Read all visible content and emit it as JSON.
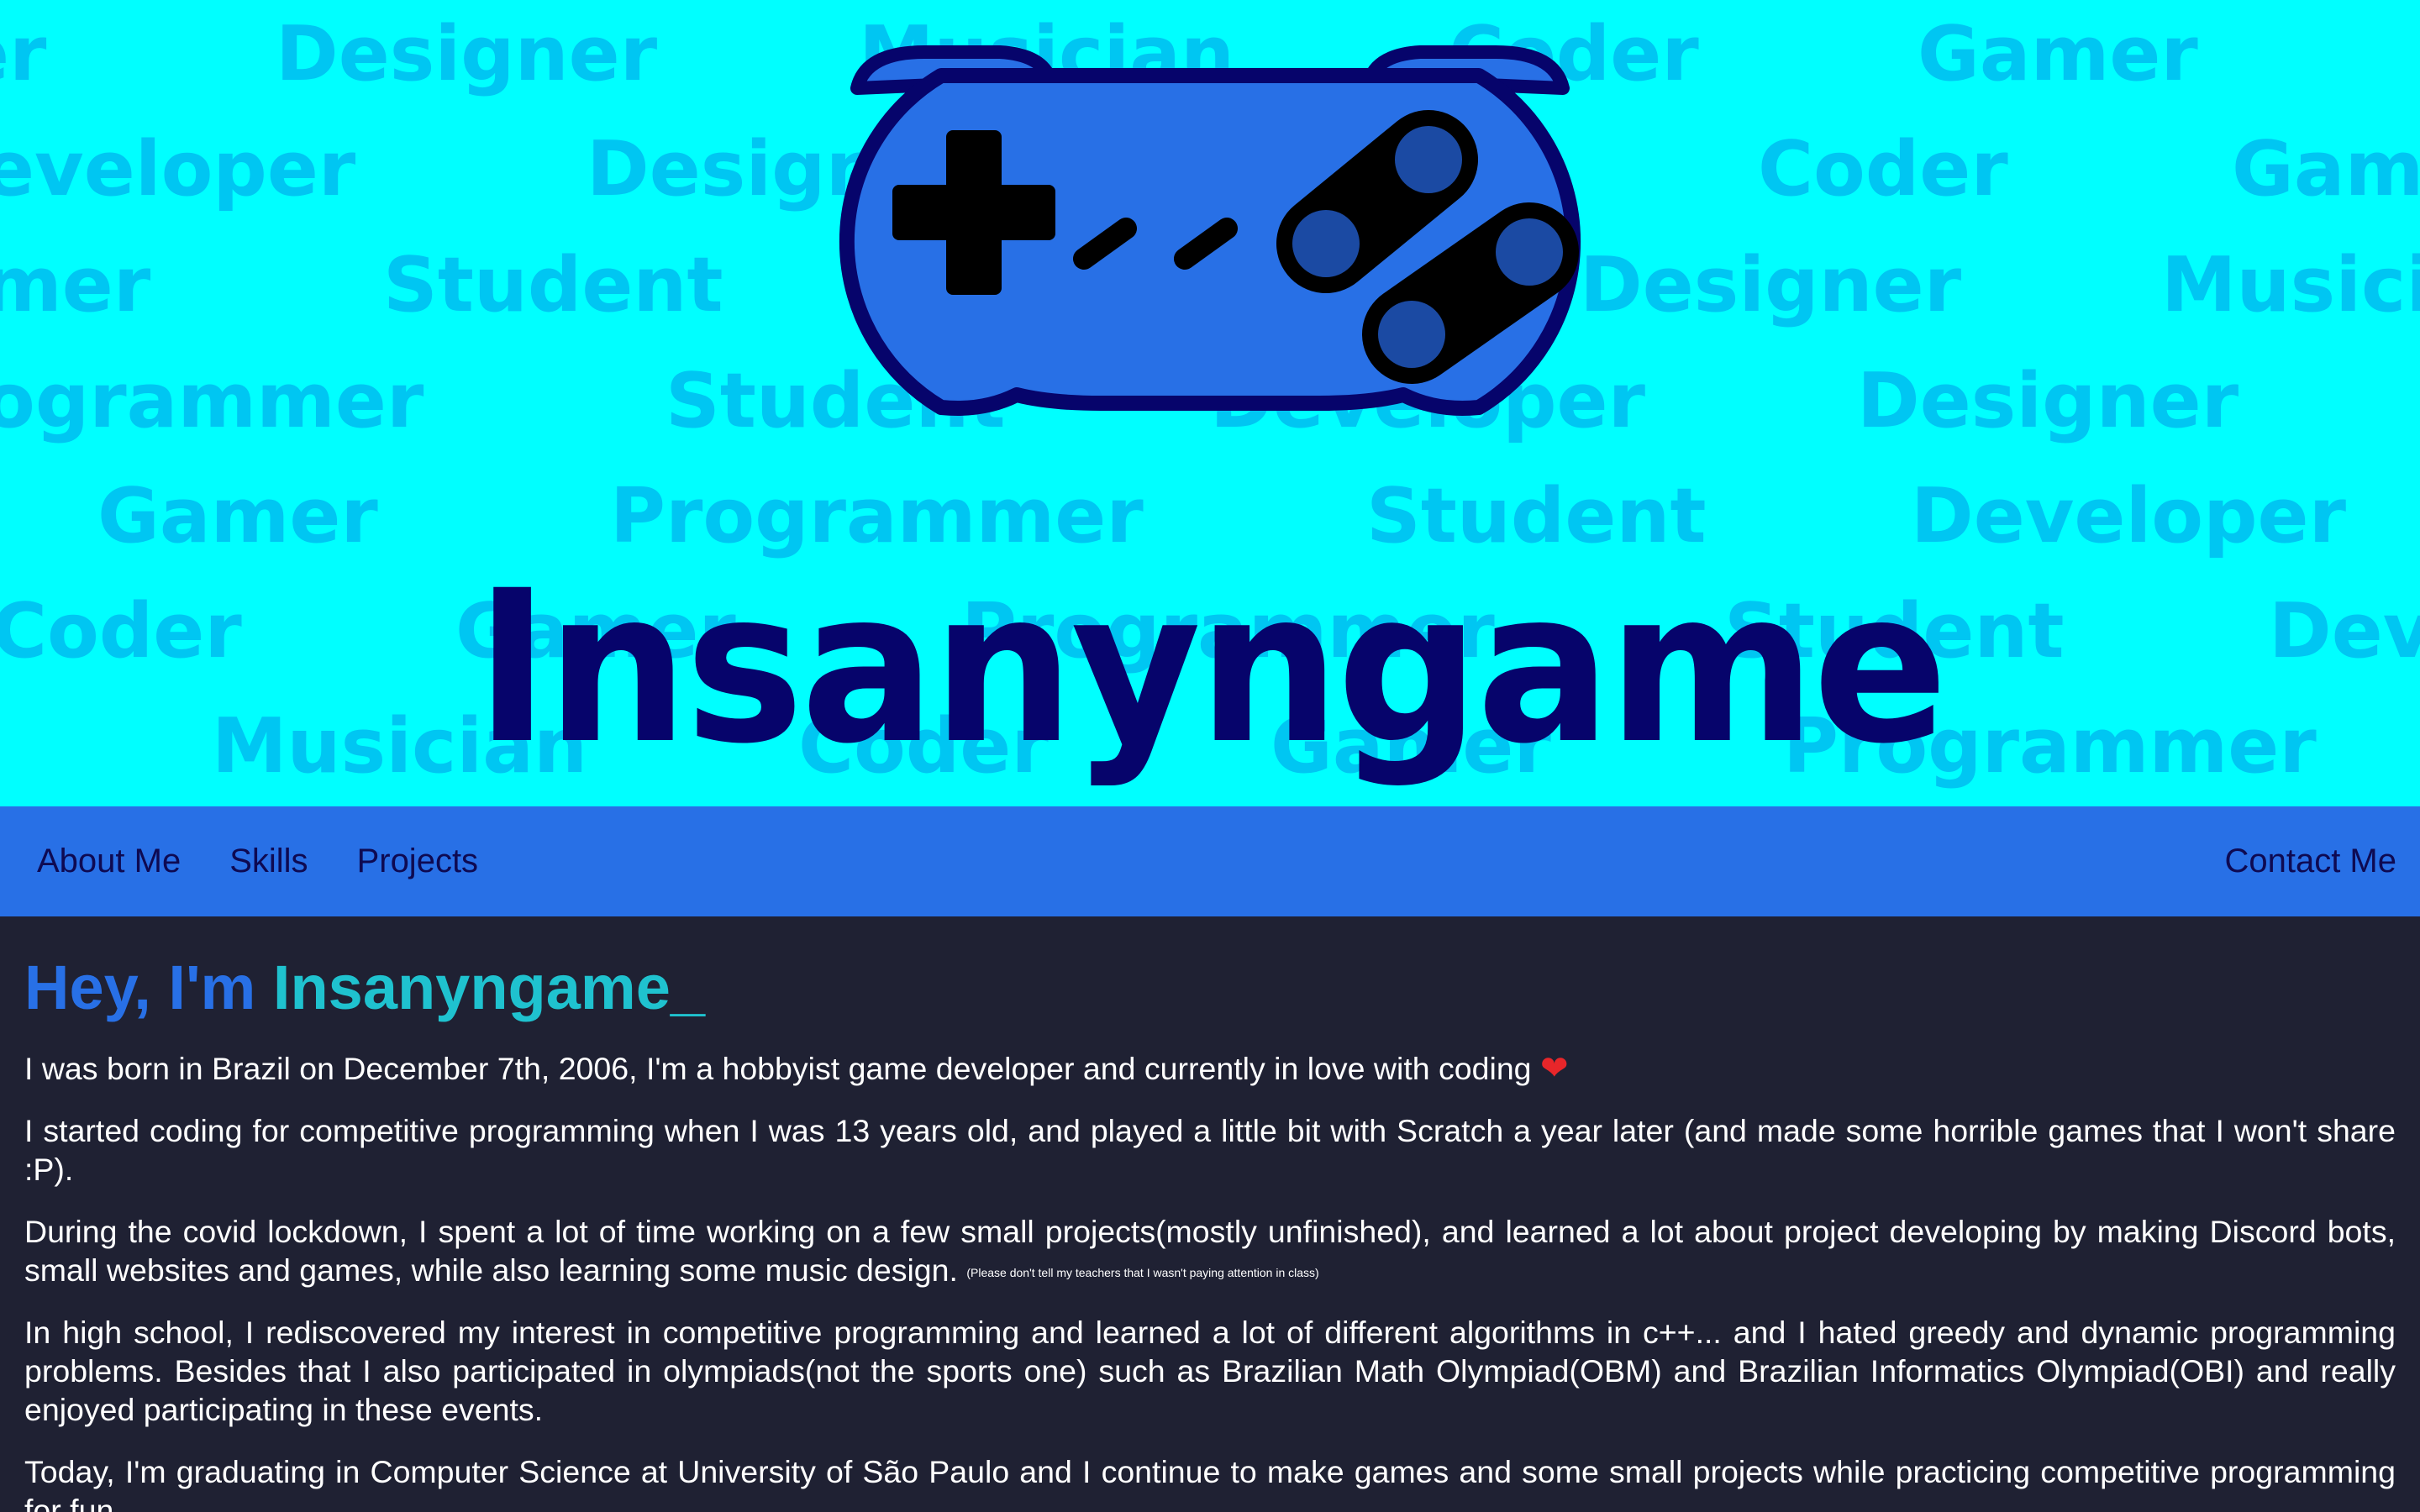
{
  "hero": {
    "brand": "Insanyngame",
    "background_words": [
      "er",
      "Designer",
      "Musician",
      "Coder",
      "Gamer",
      "eveloper",
      "Designer",
      "Coder",
      "Gamer",
      "mer",
      "Student",
      "Designer",
      "Musician",
      "ogrammer",
      "Student",
      "Developer",
      "Designer",
      "Gamer",
      "Programmer",
      "Student",
      "Developer",
      "Coder",
      "Gamer",
      "Programmer",
      "Student",
      "Developer",
      "Musician",
      "Coder",
      "Gamer",
      "Programmer"
    ],
    "colors": {
      "background": "#00ffff",
      "words": "#00c6f2",
      "brand": "#06046b",
      "controller_body": "#2870e6",
      "controller_outline": "#06046b"
    }
  },
  "nav": {
    "left": [
      "About Me",
      "Skills",
      "Projects"
    ],
    "right": "Contact Me"
  },
  "content": {
    "headline_prefix": "Hey, I'm ",
    "headline_name": "Insanyngame",
    "headline_cursor": "_",
    "p1": "I was born in Brazil on December 7th, 2006, I'm a hobbyist game developer and currently in love with coding",
    "p1_emoji": "❤",
    "p2": "I started coding for competitive programming when I was 13 years old, and played a little bit with Scratch a year later (and made some horrible games that I won't share :P).",
    "p3": "During the covid lockdown, I spent a lot of time working on a few small projects(mostly unfinished), and learned a lot about project developing by making Discord bots, small websites and games, while also learning some music design.",
    "p3_note": "(Please don't tell my teachers that I wasn't paying attention in class)",
    "p4": "In high school, I rediscovered my interest in competitive programming and learned a lot of different algorithms in c++... and I hated greedy and dynamic programming problems. Besides that I also participated in olympiads(not the sports one) such as Brazilian Math Olympiad(OBM) and Brazilian Informatics Olympiad(OBI) and really enjoyed participating in these events.",
    "p5": "Today, I'm graduating in Computer Science at University of São Paulo and I continue to make games and some small projects while practicing competitive programming for fun."
  },
  "colors": {
    "page_background": "#1f2133",
    "nav_background": "#2870e6",
    "nav_text": "#0e0a52",
    "headline_prefix": "#2870e6",
    "headline_name": "#1fc2cf",
    "body_text": "#ffffff",
    "heart": "#e8262a"
  }
}
